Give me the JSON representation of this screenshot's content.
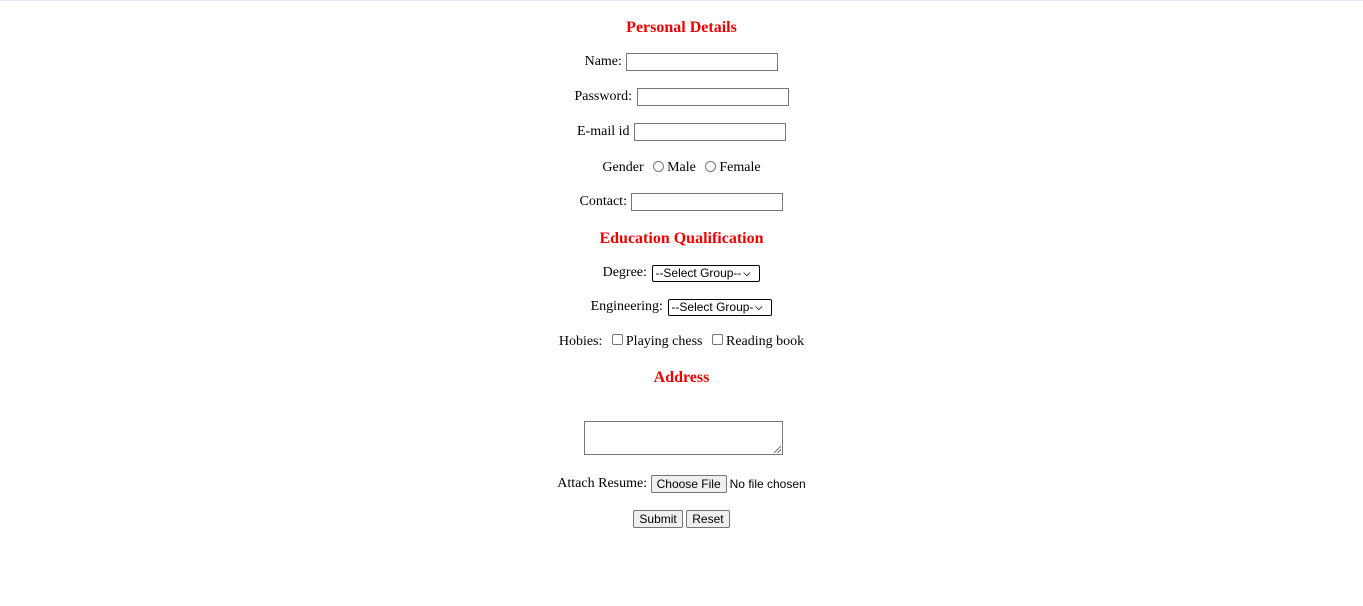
{
  "sections": {
    "personal": "Personal Details",
    "education": "Education Qualification",
    "address": "Address"
  },
  "fields": {
    "name_label": "Name:",
    "password_label": "Password:",
    "email_label": "E-mail id",
    "gender_label": "Gender",
    "gender_options": [
      "Male",
      "Female"
    ],
    "contact_label": "Contact:",
    "degree_label": "Degree:",
    "degree_selected": "--Select Group--",
    "engineering_label": "Engineering:",
    "engineering_selected": "--Select Group-",
    "hobbies_label": "Hobies:",
    "hobby_options": [
      "Playing chess",
      "Reading book"
    ],
    "resume_label": "Attach Resume:",
    "file_button": "Choose File",
    "file_status": "No file chosen"
  },
  "buttons": {
    "submit": "Submit",
    "reset": "Reset"
  },
  "icons": {
    "select_arrow": "chevron-down-icon",
    "resize_grip": "resize-grip-icon"
  },
  "colors": {
    "heading": "#ee0000"
  }
}
